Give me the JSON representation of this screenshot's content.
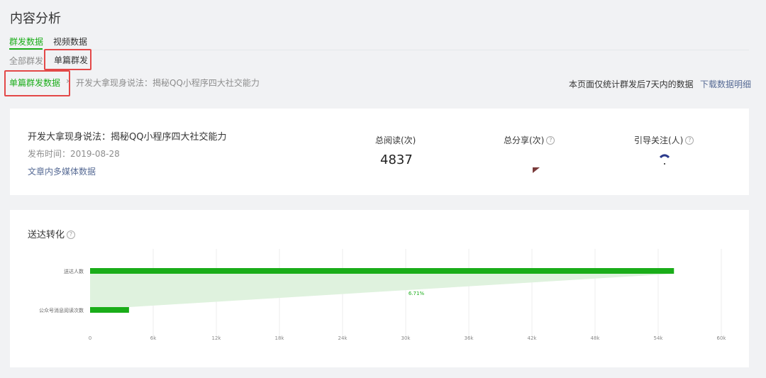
{
  "page": {
    "title": "内容分析"
  },
  "tabs": [
    {
      "label": "群发数据",
      "active": true
    },
    {
      "label": "视频数据",
      "active": false
    }
  ],
  "subtabs": [
    {
      "label": "全部群发",
      "selected": false
    },
    {
      "label": "单篇群发",
      "selected": true
    }
  ],
  "breadcrumb": {
    "root": "单篇群发数据",
    "separator": "›",
    "current": "开发大拿现身说法：揭秘QQ小程序四大社交能力"
  },
  "notice": "本页面仅统计群发后7天内的数据",
  "download_link": "下载数据明细",
  "article": {
    "title": "开发大拿现身说法：揭秘QQ小程序四大社交能力",
    "publish": "发布时间：2019-08-28",
    "media_link": "文章内多媒体数据"
  },
  "stats": [
    {
      "label": "总阅读(次)",
      "value": "4837",
      "help": false
    },
    {
      "label": "总分享(次)",
      "value": "",
      "help": true
    },
    {
      "label": "引导关注(人)",
      "value": "",
      "help": true
    }
  ],
  "conversion": {
    "title": "送达转化",
    "help": true
  },
  "colors": {
    "accent": "#1aad19",
    "funnel": "#dff2de",
    "link": "#576b95",
    "highlight": "#e34848"
  },
  "chart_data": {
    "type": "bar",
    "orientation": "horizontal",
    "categories": [
      "送达人数",
      "公众号消息阅读次数"
    ],
    "values": [
      55500,
      3700
    ],
    "annotation": "6.71%",
    "xlim": [
      0,
      60000
    ],
    "xticks": [
      "0",
      "6k",
      "12k",
      "18k",
      "24k",
      "30k",
      "36k",
      "42k",
      "48k",
      "54k",
      "60k"
    ],
    "tick_values": [
      0,
      6000,
      12000,
      18000,
      24000,
      30000,
      36000,
      42000,
      48000,
      54000,
      60000
    ],
    "grid": true
  }
}
